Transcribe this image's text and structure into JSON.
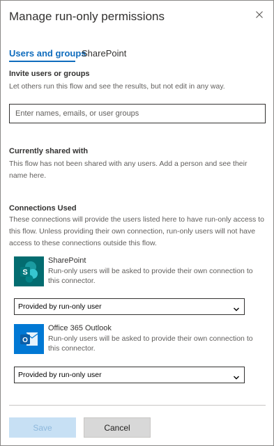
{
  "dialog": {
    "title": "Manage run-only permissions",
    "close_icon": "close-icon"
  },
  "tabs": [
    {
      "label": "Users and groups",
      "active": true
    },
    {
      "label": "SharePoint",
      "active": false
    }
  ],
  "invite": {
    "title": "Invite users or groups",
    "description": "Let others run this flow and see the results, but not edit in any way.",
    "placeholder": "Enter names, emails, or user groups",
    "value": ""
  },
  "shared": {
    "title": "Currently shared with",
    "description": "This flow has not been shared with any users. Add a person and see their name here."
  },
  "connections": {
    "title": "Connections Used",
    "description": "These connections will provide the users listed here to have run-only access to this flow. Unless providing their own connection, run-only users will not have access to these connections outside this flow.",
    "items": [
      {
        "name": "SharePoint",
        "icon": "sharepoint-icon",
        "color": "#036c70",
        "description": "Run-only users will be asked to provide their own connection to this connector.",
        "selected": "Provided by run-only user"
      },
      {
        "name": "Office 365 Outlook",
        "icon": "outlook-icon",
        "color": "#0078d4",
        "description": "Run-only users will be asked to provide their own connection to this connector.",
        "selected": "Provided by run-only user"
      }
    ]
  },
  "footer": {
    "save_label": "Save",
    "cancel_label": "Cancel"
  },
  "colors": {
    "accent": "#0f6cbd",
    "save_disabled_bg": "#c7e0f4",
    "cancel_bg": "#d8d8d8"
  }
}
